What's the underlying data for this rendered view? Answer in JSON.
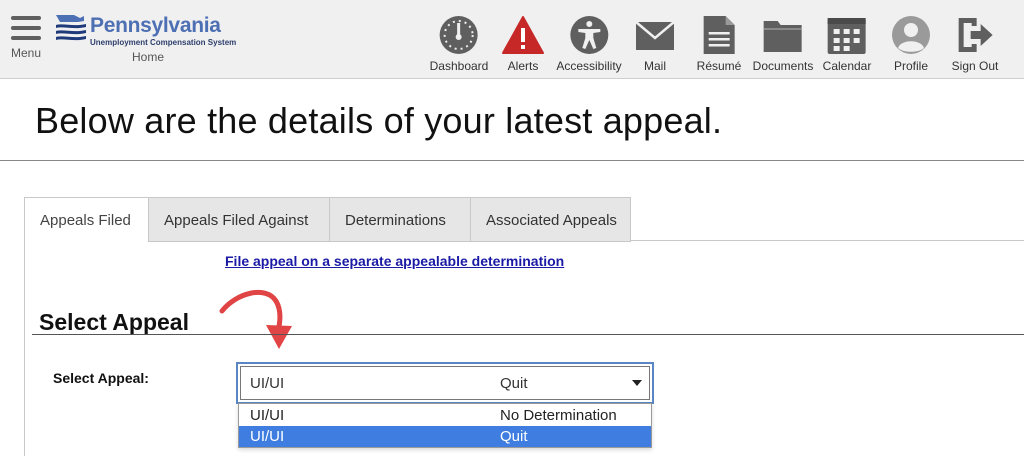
{
  "header": {
    "menu_label": "Menu",
    "logo_title": "Pennsylvania",
    "logo_subtitle": "Unemployment Compensation System",
    "home_label": "Home",
    "nav": [
      {
        "label": "Dashboard",
        "icon": "dashboard-gauge-icon"
      },
      {
        "label": "Alerts",
        "icon": "alert-triangle-icon"
      },
      {
        "label": "Accessibility",
        "icon": "accessibility-icon"
      },
      {
        "label": "Mail",
        "icon": "mail-envelope-icon"
      },
      {
        "label": "Résumé",
        "icon": "resume-document-icon"
      },
      {
        "label": "Documents",
        "icon": "folder-icon"
      },
      {
        "label": "Calendar",
        "icon": "calendar-icon"
      },
      {
        "label": "Profile",
        "icon": "profile-user-icon"
      },
      {
        "label": "Sign Out",
        "icon": "sign-out-icon"
      }
    ]
  },
  "page": {
    "title": "Below are the details of your latest appeal."
  },
  "tabs": [
    {
      "label": "Appeals Filed",
      "active": true
    },
    {
      "label": "Appeals Filed Against",
      "active": false
    },
    {
      "label": "Determinations",
      "active": false
    },
    {
      "label": "Associated Appeals",
      "active": false
    }
  ],
  "main": {
    "link_text": "File appeal on a separate appealable determination",
    "section_title": "Select Appeal",
    "field_label": "Select Appeal:",
    "select": {
      "value_type": "UI/UI",
      "value_reason": "Quit"
    },
    "options": [
      {
        "type": "UI/UI",
        "reason": "No Determination",
        "selected": false
      },
      {
        "type": "UI/UI",
        "reason": "Quit",
        "selected": true
      }
    ]
  },
  "colors": {
    "accent_blue": "#3f7ee0",
    "link_blue": "#1a1aa6",
    "alert_red": "#c62828",
    "icon_gray": "#5f5f5f",
    "annotation_arrow": "#e04444"
  }
}
